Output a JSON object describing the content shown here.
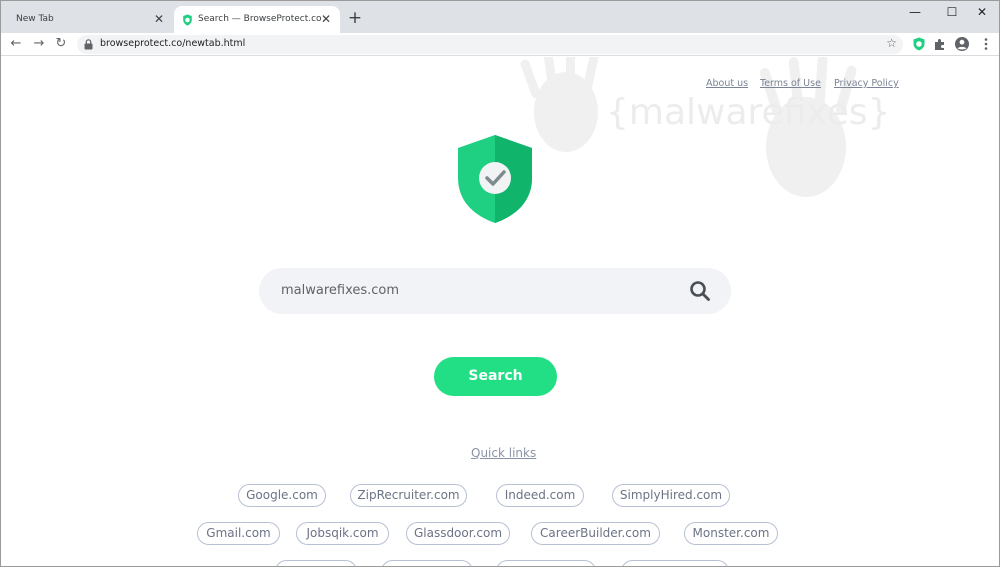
{
  "browser": {
    "tabs": [
      {
        "title": "New Tab",
        "active": false
      },
      {
        "title": "Search — BrowseProtect.co",
        "active": true
      }
    ],
    "new_tab_glyph": "+",
    "close_glyph": "✕",
    "url": "browseprotect.co/newtab.html",
    "window_controls": {
      "minimize": "—",
      "maximize": "☐",
      "close": "✕"
    },
    "nav": {
      "back": "←",
      "forward": "→",
      "reload": "↻"
    },
    "icons": [
      "lock-icon",
      "star-icon",
      "shield-extension-icon",
      "puzzle-extension-icon",
      "profile-icon",
      "menu-icon"
    ]
  },
  "watermark": {
    "text": "{malwarefixes}"
  },
  "top_links": {
    "about": "About us",
    "terms": "Terms of Use",
    "privacy": "Privacy Policy"
  },
  "search": {
    "value": "malwarefixes.com",
    "button_label": "Search"
  },
  "quick_links": {
    "title": "Quick links",
    "row1": [
      "Google.com",
      "ZipRecruiter.com",
      "Indeed.com",
      "SimplyHired.com"
    ],
    "row2": [
      "Gmail.com",
      "Jobsqik.com",
      "Glassdoor.com",
      "CareerBuilder.com",
      "Monster.com"
    ]
  },
  "colors": {
    "accent": "#22df86",
    "shield_light": "#1fd082",
    "shield_dark": "#10b46a",
    "link_gray": "#7b8494"
  }
}
